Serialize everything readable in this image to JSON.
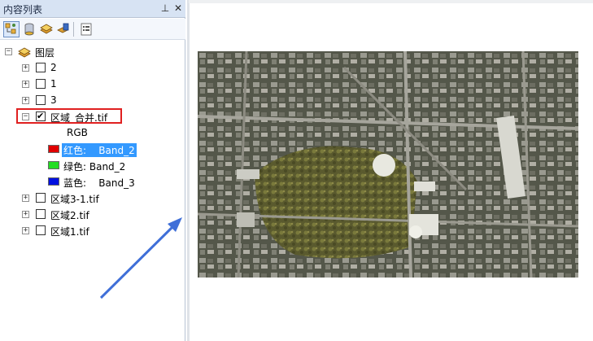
{
  "panel": {
    "title": "内容列表",
    "pin_glyph": "⊥",
    "close_glyph": "✕"
  },
  "toolbar": {
    "buttons": [
      {
        "icon": "list-by-drawing-order-icon",
        "active": true
      },
      {
        "icon": "list-by-source-icon",
        "active": false
      },
      {
        "icon": "list-by-visibility-icon",
        "active": false
      },
      {
        "icon": "list-by-selection-icon",
        "active": false
      },
      {
        "icon": "options-icon",
        "active": false
      }
    ]
  },
  "tree": {
    "root_label": "图层",
    "layers": [
      {
        "label": "2",
        "checked": false,
        "expanded": false
      },
      {
        "label": "1",
        "checked": false,
        "expanded": false
      },
      {
        "label": "3",
        "checked": false,
        "expanded": false
      },
      {
        "label": "区域_合并.tif",
        "checked": true,
        "expanded": true
      },
      {
        "label": "区域3-1.tif",
        "checked": false,
        "expanded": false
      },
      {
        "label": "区域2.tif",
        "checked": false,
        "expanded": false
      },
      {
        "label": "区域1.tif",
        "checked": false,
        "expanded": false
      }
    ],
    "rgb_label": "RGB",
    "bands": [
      {
        "label": "红色:    Band_2",
        "color": "#e00000",
        "selected": true
      },
      {
        "label": "绿色: Band_2",
        "color": "#22dd22",
        "selected": false
      },
      {
        "label": "蓝色:    Band_3",
        "color": "#0010e0",
        "selected": false
      }
    ]
  },
  "colors": {
    "highlight": "#3399ff",
    "annotation_box": "#e02020",
    "arrow": "#3f6fd8"
  }
}
